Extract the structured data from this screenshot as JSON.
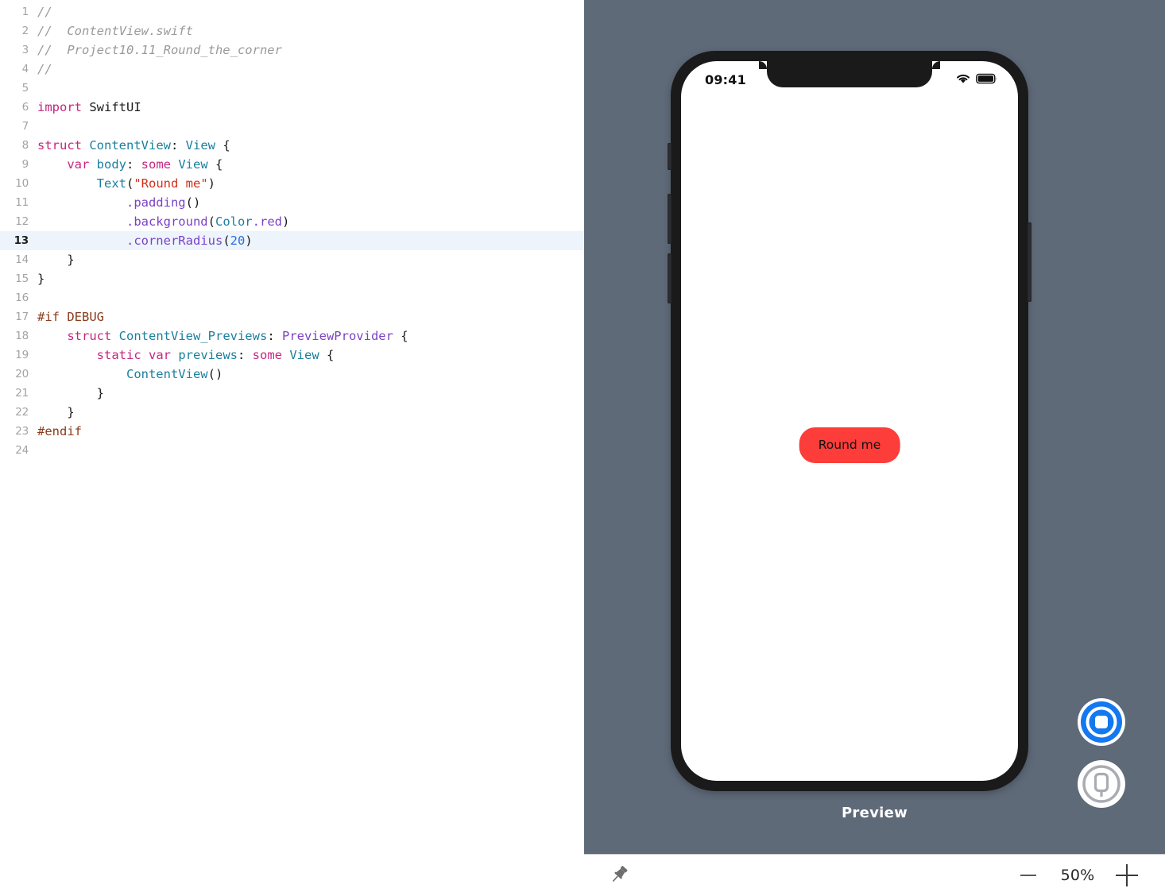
{
  "editor": {
    "name": "code-editor",
    "language": "swift",
    "highlighted_line": 13,
    "lines": [
      {
        "n": "1",
        "tokens": [
          {
            "t": "//",
            "c": "t-com"
          }
        ]
      },
      {
        "n": "2",
        "tokens": [
          {
            "t": "//  ContentView.swift",
            "c": "t-com"
          }
        ]
      },
      {
        "n": "3",
        "tokens": [
          {
            "t": "//  Project10.11_Round_the_corner",
            "c": "t-com"
          }
        ]
      },
      {
        "n": "4",
        "tokens": [
          {
            "t": "//",
            "c": "t-com"
          }
        ]
      },
      {
        "n": "5",
        "tokens": []
      },
      {
        "n": "6",
        "tokens": [
          {
            "t": "import",
            "c": "t-kw"
          },
          {
            "t": " SwiftUI",
            "c": "t-plain"
          }
        ]
      },
      {
        "n": "7",
        "tokens": []
      },
      {
        "n": "8",
        "tokens": [
          {
            "t": "struct",
            "c": "t-kw"
          },
          {
            "t": " ",
            "c": "t-plain"
          },
          {
            "t": "ContentView",
            "c": "t-type"
          },
          {
            "t": ": ",
            "c": "t-plain"
          },
          {
            "t": "View",
            "c": "t-type"
          },
          {
            "t": " {",
            "c": "t-plain"
          }
        ]
      },
      {
        "n": "9",
        "tokens": [
          {
            "t": "    ",
            "c": "t-plain"
          },
          {
            "t": "var",
            "c": "t-kw"
          },
          {
            "t": " ",
            "c": "t-plain"
          },
          {
            "t": "body",
            "c": "t-type"
          },
          {
            "t": ": ",
            "c": "t-plain"
          },
          {
            "t": "some",
            "c": "t-kw"
          },
          {
            "t": " ",
            "c": "t-plain"
          },
          {
            "t": "View",
            "c": "t-type"
          },
          {
            "t": " {",
            "c": "t-plain"
          }
        ]
      },
      {
        "n": "10",
        "tokens": [
          {
            "t": "        ",
            "c": "t-plain"
          },
          {
            "t": "Text",
            "c": "t-type"
          },
          {
            "t": "(",
            "c": "t-plain"
          },
          {
            "t": "\"Round me\"",
            "c": "t-str"
          },
          {
            "t": ")",
            "c": "t-plain"
          }
        ]
      },
      {
        "n": "11",
        "tokens": [
          {
            "t": "            ",
            "c": "t-plain"
          },
          {
            "t": ".padding",
            "c": "t-meth"
          },
          {
            "t": "()",
            "c": "t-plain"
          }
        ]
      },
      {
        "n": "12",
        "tokens": [
          {
            "t": "            ",
            "c": "t-plain"
          },
          {
            "t": ".background",
            "c": "t-meth"
          },
          {
            "t": "(",
            "c": "t-plain"
          },
          {
            "t": "Color",
            "c": "t-type"
          },
          {
            "t": ".red",
            "c": "t-meth"
          },
          {
            "t": ")",
            "c": "t-plain"
          }
        ]
      },
      {
        "n": "13",
        "tokens": [
          {
            "t": "            ",
            "c": "t-plain"
          },
          {
            "t": ".cornerRadius",
            "c": "t-meth"
          },
          {
            "t": "(",
            "c": "t-plain"
          },
          {
            "t": "20",
            "c": "t-num"
          },
          {
            "t": ")",
            "c": "t-plain"
          }
        ],
        "highlight": true
      },
      {
        "n": "14",
        "tokens": [
          {
            "t": "    }",
            "c": "t-plain"
          }
        ]
      },
      {
        "n": "15",
        "tokens": [
          {
            "t": "}",
            "c": "t-plain"
          }
        ]
      },
      {
        "n": "16",
        "tokens": []
      },
      {
        "n": "17",
        "tokens": [
          {
            "t": "#if DEBUG",
            "c": "t-pp"
          }
        ]
      },
      {
        "n": "18",
        "tokens": [
          {
            "t": "    ",
            "c": "t-plain"
          },
          {
            "t": "struct",
            "c": "t-kw"
          },
          {
            "t": " ",
            "c": "t-plain"
          },
          {
            "t": "ContentView_Previews",
            "c": "t-type"
          },
          {
            "t": ": ",
            "c": "t-plain"
          },
          {
            "t": "PreviewProvider",
            "c": "t-meth"
          },
          {
            "t": " {",
            "c": "t-plain"
          }
        ]
      },
      {
        "n": "19",
        "tokens": [
          {
            "t": "        ",
            "c": "t-plain"
          },
          {
            "t": "static",
            "c": "t-kw"
          },
          {
            "t": " ",
            "c": "t-plain"
          },
          {
            "t": "var",
            "c": "t-kw"
          },
          {
            "t": " ",
            "c": "t-plain"
          },
          {
            "t": "previews",
            "c": "t-type"
          },
          {
            "t": ": ",
            "c": "t-plain"
          },
          {
            "t": "some",
            "c": "t-kw"
          },
          {
            "t": " ",
            "c": "t-plain"
          },
          {
            "t": "View",
            "c": "t-type"
          },
          {
            "t": " {",
            "c": "t-plain"
          }
        ]
      },
      {
        "n": "20",
        "tokens": [
          {
            "t": "            ",
            "c": "t-plain"
          },
          {
            "t": "ContentView",
            "c": "t-type"
          },
          {
            "t": "()",
            "c": "t-plain"
          }
        ]
      },
      {
        "n": "21",
        "tokens": [
          {
            "t": "        }",
            "c": "t-plain"
          }
        ]
      },
      {
        "n": "22",
        "tokens": [
          {
            "t": "    }",
            "c": "t-plain"
          }
        ]
      },
      {
        "n": "23",
        "tokens": [
          {
            "t": "#endif",
            "c": "t-pp"
          }
        ]
      },
      {
        "n": "24",
        "tokens": []
      }
    ]
  },
  "preview": {
    "label": "Preview",
    "canvas_background": "#5f6a79",
    "device": {
      "status_bar": {
        "time": "09:41",
        "wifi_icon": "wifi-icon",
        "battery_icon": "battery-icon"
      },
      "content": {
        "button_label": "Round me",
        "button_color": "#fc3d39",
        "corner_radius": "20"
      },
      "side_buttons": [
        "silent-switch",
        "volume-up",
        "volume-down",
        "power"
      ]
    },
    "controls": [
      {
        "name": "live-preview-button",
        "icon": "live-preview-icon",
        "color": "#1478f0",
        "active": true
      },
      {
        "name": "device-preview-button",
        "icon": "device-preview-icon",
        "color": "#c7c9cc",
        "active": false
      }
    ]
  },
  "toolbar": {
    "pin_icon": "pin-icon",
    "zoom_out_label": "—",
    "zoom_in_label": "+",
    "zoom_value": "50%"
  }
}
